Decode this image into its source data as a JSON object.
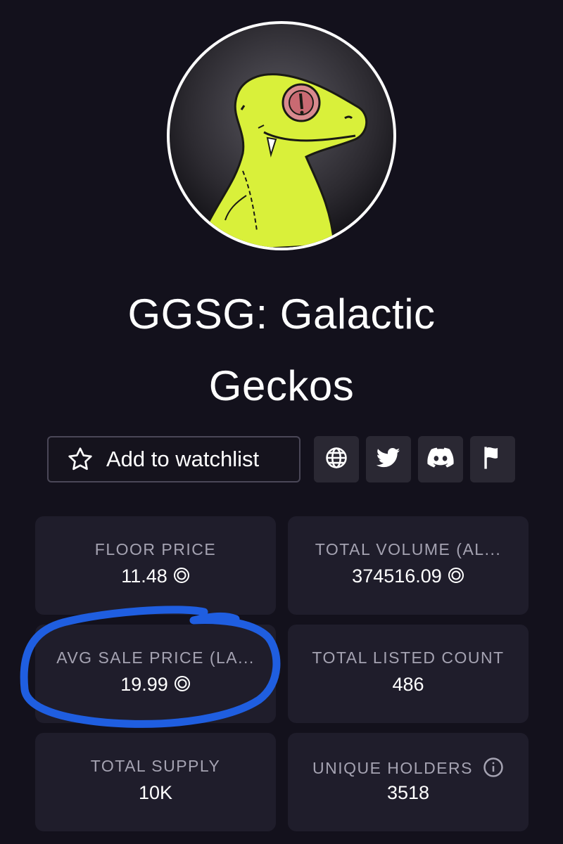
{
  "collection": {
    "title_line1": "GGSG: Galactic",
    "title_line2": "Geckos",
    "avatar_icon": "gecko-avatar"
  },
  "actions": {
    "watchlist_label": "Add to watchlist",
    "watchlist_icon": "star-icon",
    "website_icon": "globe-icon",
    "twitter_icon": "twitter-icon",
    "discord_icon": "discord-icon",
    "report_icon": "flag-icon"
  },
  "stats": {
    "floor_price": {
      "label": "FLOOR PRICE",
      "value": "11.48"
    },
    "total_volume": {
      "label": "TOTAL VOLUME (AL...",
      "value": "374516.09"
    },
    "avg_sale_price": {
      "label": "AVG SALE PRICE (LA...",
      "value": "19.99"
    },
    "total_listed": {
      "label": "TOTAL LISTED COUNT",
      "value": "486"
    },
    "total_supply": {
      "label": "TOTAL SUPPLY",
      "value": "10K"
    },
    "unique_holders": {
      "label": "UNIQUE HOLDERS",
      "value": "3518",
      "icon": "info-icon"
    }
  },
  "currency_icon": "sol-icon",
  "annotation": {
    "color": "#1f5ee0",
    "shape": "hand-drawn-circle"
  },
  "colors": {
    "background": "#13111c",
    "card": "#1f1d2b",
    "label": "#a5a3b2",
    "gecko": "#d9f03a"
  }
}
